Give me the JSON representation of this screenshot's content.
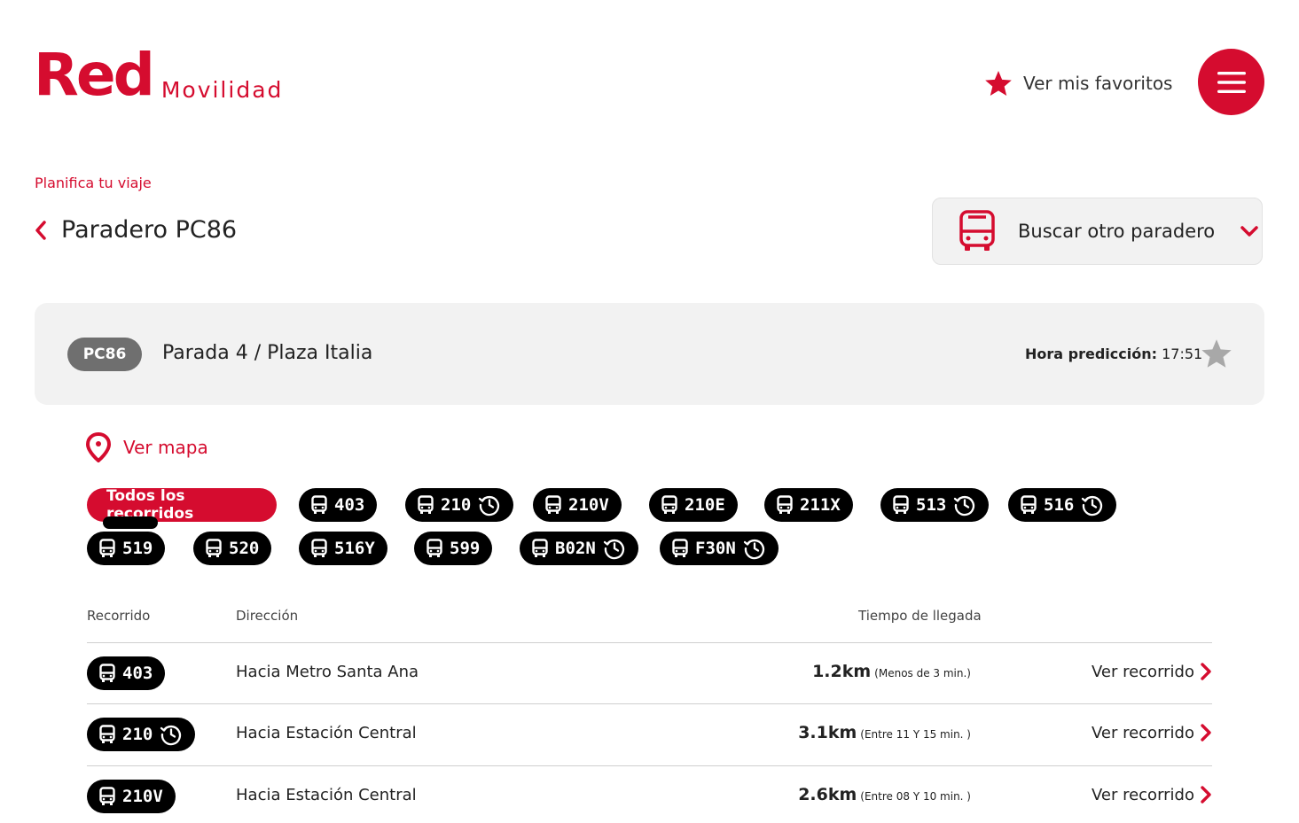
{
  "header": {
    "logo_red": "Red",
    "logo_movilidad": "Movilidad",
    "favorites_label": "Ver mis favoritos"
  },
  "breadcrumb": "Planifica tu viaje",
  "page_title": "Paradero PC86",
  "search_other_stop": "Buscar otro paradero",
  "stop": {
    "code": "PC86",
    "name": "Parada 4 / Plaza Italia",
    "prediction_label": "Hora predicción:",
    "prediction_time": "17:51"
  },
  "map_link": "Ver mapa",
  "filters": {
    "all_label": "Todos los recorridos",
    "routes": [
      {
        "label": "403",
        "clock": false
      },
      {
        "label": "210",
        "clock": true
      },
      {
        "label": "210V",
        "clock": false
      },
      {
        "label": "210E",
        "clock": false
      },
      {
        "label": "211X",
        "clock": false
      },
      {
        "label": "513",
        "clock": true
      },
      {
        "label": "516",
        "clock": true
      },
      {
        "label": "519",
        "clock": false
      },
      {
        "label": "520",
        "clock": false
      },
      {
        "label": "516Y",
        "clock": false
      },
      {
        "label": "599",
        "clock": false
      },
      {
        "label": "B02N",
        "clock": true
      },
      {
        "label": "F30N",
        "clock": true
      }
    ]
  },
  "table": {
    "headers": {
      "route": "Recorrido",
      "direction": "Dirección",
      "arrival": "Tiempo de llegada"
    },
    "rows": [
      {
        "route": "403",
        "clock": false,
        "direction": "Hacia Metro Santa Ana",
        "distance": "1.2km",
        "eta": "(Menos de 3 min.)",
        "link": "Ver recorrido"
      },
      {
        "route": "210",
        "clock": true,
        "direction": "Hacia Estación Central",
        "distance": "3.1km",
        "eta": "(Entre 11 Y 15 min. )",
        "link": "Ver recorrido"
      },
      {
        "route": "210V",
        "clock": false,
        "direction": "Hacia Estación Central",
        "distance": "2.6km",
        "eta": "(Entre 08 Y 10 min. )",
        "link": "Ver recorrido"
      }
    ]
  },
  "colors": {
    "brand_red": "#d50c2f",
    "chip_black": "#000000",
    "card_gray": "#f2f2f2"
  },
  "icons": [
    "star-icon",
    "menu-icon",
    "chevron-left-icon",
    "bus-icon",
    "chevron-down-icon",
    "location-pin-icon",
    "clock-icon",
    "chevron-right-icon"
  ]
}
